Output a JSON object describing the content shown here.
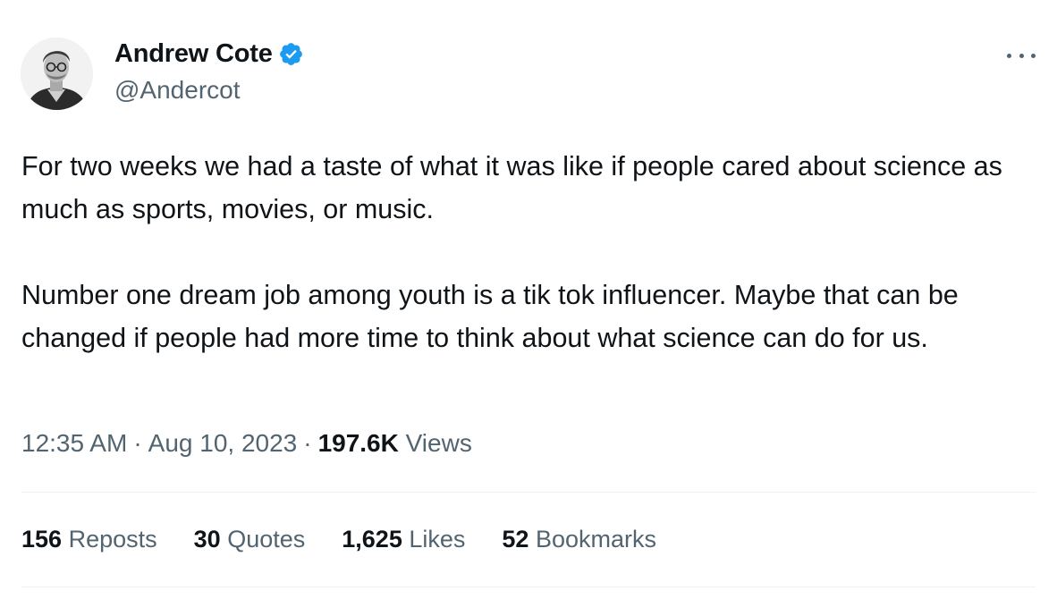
{
  "author": {
    "display_name": "Andrew Cote",
    "handle": "@Andercot",
    "verified": true,
    "verified_color": "#1d9bf0"
  },
  "tweet": {
    "paragraphs": [
      "For two weeks we had a taste of what it was like if people cared about science as much as sports, movies, or music.",
      "Number one dream job among youth is a tik tok influencer. Maybe that can be changed if people had more time to think about what science can do for us."
    ],
    "time": "12:35 AM",
    "separator": "·",
    "date": "Aug 10, 2023",
    "views_count": "197.6K",
    "views_label": "Views"
  },
  "stats": [
    {
      "count": "156",
      "label": "Reposts"
    },
    {
      "count": "30",
      "label": "Quotes"
    },
    {
      "count": "1,625",
      "label": "Likes"
    },
    {
      "count": "52",
      "label": "Bookmarks"
    }
  ],
  "icons": {
    "more": "more-options-icon",
    "verified": "verified-badge-icon"
  },
  "colors": {
    "text_primary": "#0f1419",
    "text_secondary": "#536471",
    "divider": "#eff3f4"
  }
}
